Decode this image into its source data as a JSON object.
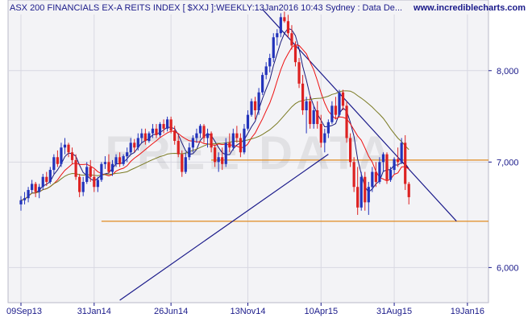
{
  "header": {
    "title": "ASX 200 FINANCIALS EX-A REITS INDEX [ $XXJ ]:WEEKLY:13Jan2016 10:43 Sydney : Data De...",
    "site": "www.incrediblecharts.com"
  },
  "watermark": "FREE DATA",
  "colors": {
    "plot_bg": "#f3f3f6",
    "frame": "#b8b8c8",
    "up": "#2233bb",
    "down": "#dd2222",
    "ma_fast": "#1a1a7a",
    "ma_mid": "#ee1111",
    "ma_slow": "#7a7a22",
    "support": "#e08a1e",
    "trendline": "#1a1a8a",
    "axis_text": "#1a1a8a"
  },
  "chart_data": {
    "type": "candlestick",
    "period": "weekly",
    "x_tick_labels": [
      "09Sep13",
      "31Jan14",
      "26Jun14",
      "13Nov14",
      "10Apr15",
      "31Aug15",
      "19Jan16"
    ],
    "x_tick_weeks": [
      0,
      20,
      41,
      62,
      82,
      102,
      122
    ],
    "y_tick_labels": [
      "8,000",
      "7,000",
      "6,000"
    ],
    "y_ticks": [
      8000,
      7000,
      6000
    ],
    "y_range": [
      5700,
      8870
    ],
    "log_scale": true,
    "grid": true,
    "ohlc": [
      [
        6580,
        6660,
        6520,
        6620
      ],
      [
        6620,
        6700,
        6580,
        6640
      ],
      [
        6640,
        6750,
        6600,
        6720
      ],
      [
        6720,
        6820,
        6690,
        6780
      ],
      [
        6780,
        6800,
        6650,
        6700
      ],
      [
        6700,
        6780,
        6640,
        6750
      ],
      [
        6750,
        6880,
        6720,
        6850
      ],
      [
        6850,
        6900,
        6760,
        6800
      ],
      [
        6800,
        6950,
        6780,
        6920
      ],
      [
        6920,
        7080,
        6880,
        7050
      ],
      [
        7050,
        7120,
        6950,
        6980
      ],
      [
        6980,
        7200,
        6950,
        7150
      ],
      [
        7150,
        7250,
        7080,
        7180
      ],
      [
        7180,
        7200,
        7050,
        7100
      ],
      [
        7100,
        7150,
        6980,
        7020
      ],
      [
        7020,
        7080,
        6820,
        6850
      ],
      [
        6850,
        6880,
        6650,
        6700
      ],
      [
        6700,
        6850,
        6660,
        6800
      ],
      [
        6800,
        7000,
        6780,
        6950
      ],
      [
        6950,
        7020,
        6800,
        6850
      ],
      [
        6850,
        6920,
        6700,
        6750
      ],
      [
        6750,
        6850,
        6700,
        6820
      ],
      [
        6820,
        7000,
        6800,
        6980
      ],
      [
        6980,
        7060,
        6930,
        7000
      ],
      [
        7000,
        7080,
        6880,
        6900
      ],
      [
        6900,
        7020,
        6860,
        6980
      ],
      [
        6980,
        7080,
        6950,
        7050
      ],
      [
        7050,
        7100,
        6950,
        6980
      ],
      [
        6980,
        7080,
        6960,
        7060
      ],
      [
        7060,
        7150,
        7000,
        7100
      ],
      [
        7100,
        7250,
        7080,
        7200
      ],
      [
        7200,
        7240,
        7100,
        7150
      ],
      [
        7150,
        7300,
        7120,
        7250
      ],
      [
        7250,
        7350,
        7200,
        7300
      ],
      [
        7300,
        7350,
        7180,
        7220
      ],
      [
        7220,
        7320,
        7200,
        7300
      ],
      [
        7300,
        7400,
        7250,
        7350
      ],
      [
        7350,
        7400,
        7250,
        7280
      ],
      [
        7280,
        7420,
        7260,
        7400
      ],
      [
        7400,
        7450,
        7300,
        7350
      ],
      [
        7350,
        7480,
        7320,
        7450
      ],
      [
        7450,
        7480,
        7300,
        7330
      ],
      [
        7330,
        7380,
        7180,
        7220
      ],
      [
        7220,
        7280,
        7050,
        7080
      ],
      [
        7080,
        7120,
        6850,
        6900
      ],
      [
        6900,
        7100,
        6880,
        7050
      ],
      [
        7050,
        7200,
        7020,
        7150
      ],
      [
        7150,
        7280,
        7100,
        7250
      ],
      [
        7250,
        7350,
        7200,
        7300
      ],
      [
        7300,
        7400,
        7250,
        7380
      ],
      [
        7380,
        7400,
        7200,
        7250
      ],
      [
        7250,
        7350,
        7150,
        7300
      ],
      [
        7300,
        7320,
        7100,
        7150
      ],
      [
        7150,
        7180,
        6950,
        7000
      ],
      [
        7000,
        7100,
        6900,
        7050
      ],
      [
        7050,
        7150,
        6920,
        6980
      ],
      [
        6980,
        7250,
        6950,
        7200
      ],
      [
        7200,
        7300,
        7100,
        7150
      ],
      [
        7150,
        7350,
        7120,
        7300
      ],
      [
        7300,
        7380,
        7200,
        7250
      ],
      [
        7250,
        7300,
        7050,
        7100
      ],
      [
        7100,
        7400,
        7080,
        7350
      ],
      [
        7350,
        7550,
        7330,
        7500
      ],
      [
        7500,
        7680,
        7480,
        7650
      ],
      [
        7650,
        7700,
        7450,
        7550
      ],
      [
        7550,
        7800,
        7500,
        7750
      ],
      [
        7750,
        7980,
        7720,
        7950
      ],
      [
        7950,
        8100,
        7900,
        8050
      ],
      [
        8050,
        8200,
        7980,
        8150
      ],
      [
        8150,
        8450,
        8100,
        8400
      ],
      [
        8400,
        8500,
        8300,
        8450
      ],
      [
        8450,
        8700,
        8400,
        8650
      ],
      [
        8650,
        8720,
        8580,
        8600
      ],
      [
        8600,
        8680,
        8400,
        8450
      ],
      [
        8450,
        8550,
        8250,
        8300
      ],
      [
        8300,
        8350,
        8050,
        8100
      ],
      [
        8100,
        8150,
        7800,
        7850
      ],
      [
        7850,
        7950,
        7500,
        7550
      ],
      [
        7550,
        7700,
        7300,
        7650
      ],
      [
        7650,
        7720,
        7350,
        7400
      ],
      [
        7400,
        7600,
        7350,
        7550
      ],
      [
        7550,
        7650,
        7350,
        7400
      ],
      [
        7400,
        7500,
        7150,
        7200
      ],
      [
        7200,
        7350,
        7100,
        7300
      ],
      [
        7300,
        7450,
        7250,
        7420
      ],
      [
        7420,
        7650,
        7400,
        7600
      ],
      [
        7600,
        7700,
        7450,
        7500
      ],
      [
        7500,
        7780,
        7480,
        7750
      ],
      [
        7750,
        7780,
        7550,
        7600
      ],
      [
        7600,
        7650,
        7200,
        7250
      ],
      [
        7250,
        7300,
        6950,
        7000
      ],
      [
        7000,
        7050,
        6700,
        6750
      ],
      [
        6750,
        6950,
        6480,
        6550
      ],
      [
        6550,
        6900,
        6520,
        6850
      ],
      [
        6850,
        6900,
        6520,
        6600
      ],
      [
        6600,
        6800,
        6480,
        6750
      ],
      [
        6750,
        6950,
        6700,
        6900
      ],
      [
        6900,
        7000,
        6750,
        6800
      ],
      [
        6800,
        7050,
        6780,
        7000
      ],
      [
        7000,
        7100,
        6900,
        7080
      ],
      [
        7080,
        7100,
        6780,
        6820
      ],
      [
        6820,
        6950,
        6800,
        6920
      ],
      [
        6920,
        7050,
        6880,
        7030
      ],
      [
        7030,
        7150,
        6950,
        7000
      ],
      [
        7000,
        7250,
        6980,
        7200
      ],
      [
        7200,
        7280,
        6720,
        6780
      ],
      [
        6780,
        6800,
        6580,
        6650
      ]
    ],
    "support_levels": [
      7020,
      6420
    ],
    "trendlines": [
      {
        "start_week": 66,
        "start_value": 8750,
        "end_week": 103,
        "end_value": 7050
      },
      {
        "start_week": 27,
        "start_value": 5720,
        "end_week": 84,
        "end_value": 7080
      }
    ],
    "moving_averages": [
      {
        "key": "ma_fast",
        "period": 5
      },
      {
        "key": "ma_mid",
        "period": 10
      },
      {
        "key": "ma_slow",
        "period": 30
      }
    ]
  }
}
